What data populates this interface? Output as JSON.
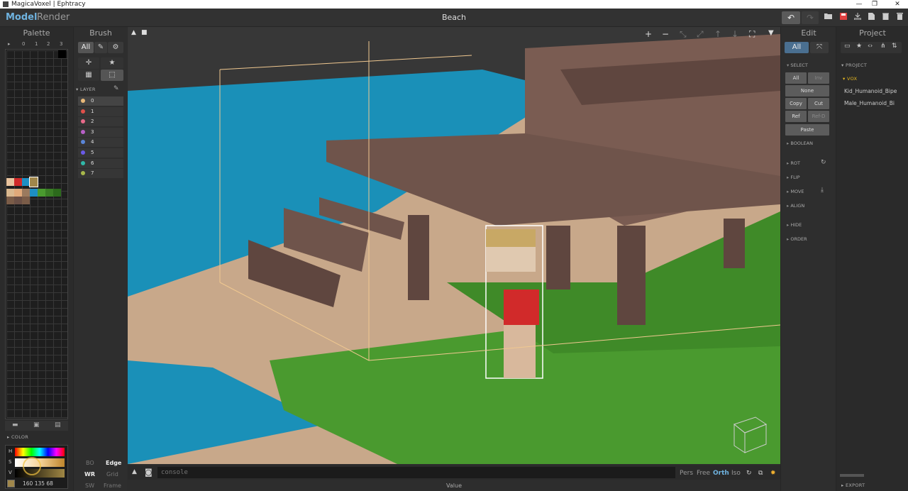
{
  "window": {
    "title": "MagicaVoxel | Ephtracy",
    "controls": [
      "—",
      "❐",
      "✕"
    ]
  },
  "menubar": {
    "tabs": [
      "Model",
      "Render"
    ],
    "scene_title": "Beach",
    "undo": "↶",
    "redo": "↷",
    "file_icons": [
      "open-folder-icon",
      "save-icon",
      "export-icon",
      "new-file-icon",
      "delete-icon"
    ]
  },
  "palette": {
    "title": "Palette",
    "header": [
      "▸",
      "0",
      "1",
      "2",
      "3"
    ],
    "swatch_colors": [
      "#e8c39e",
      "#d12a2a",
      "#1d8fc4",
      "#a0874b",
      "#d9b88f",
      "#9b7a5e",
      "#4a9a2f",
      "#3a7d25",
      "#2c6a1c",
      "#e0a97a",
      "#7a5c48",
      "#6b5046"
    ],
    "tools": [
      "open-icon",
      "save-icon",
      "file-icon"
    ],
    "color_label": "COLOR",
    "hsv_labels": [
      "H",
      "S",
      "V"
    ],
    "rgb": "160 135 68"
  },
  "brush": {
    "title": "Brush",
    "modes": [
      "All"
    ],
    "layer_label": "LAYER",
    "layers": [
      {
        "num": "0",
        "color": "#e8b878"
      },
      {
        "num": "1",
        "color": "#e0504a"
      },
      {
        "num": "2",
        "color": "#e86a8a"
      },
      {
        "num": "3",
        "color": "#b860c8"
      },
      {
        "num": "4",
        "color": "#5a86d8"
      },
      {
        "num": "5",
        "color": "#6a5ae8"
      },
      {
        "num": "6",
        "color": "#30b8a8"
      },
      {
        "num": "7",
        "color": "#a8b84a"
      }
    ],
    "bottom": [
      [
        "BO",
        "Edge"
      ],
      [
        "WR",
        "Grid"
      ],
      [
        "SW",
        "Frame"
      ]
    ]
  },
  "viewport": {
    "console_placeholder": "console",
    "camera_modes": [
      "Pers",
      "Free",
      "Orth",
      "Iso"
    ],
    "active_camera": "Orth",
    "toolbar": [
      "+",
      "−"
    ]
  },
  "status": {
    "value_label": "Value"
  },
  "edit": {
    "title": "Edit",
    "mode": "All",
    "select_label": "SELECT",
    "buttons": {
      "all": "All",
      "inv": "Inv",
      "none": "None",
      "copy": "Copy",
      "cut": "Cut",
      "ref": "Ref",
      "refd": "Ref-D",
      "paste": "Paste"
    },
    "sections": [
      "BOOLEAN",
      "ROT",
      "FLIP",
      "MOVE",
      "ALIGN",
      "HIDE",
      "ORDER"
    ]
  },
  "project": {
    "title": "Project",
    "section_label": "PROJECT",
    "folder": "VOX",
    "items": [
      "Kid_Humanoid_Bipe",
      "Male_Humanoid_Bi"
    ],
    "export_label": "EXPORT"
  }
}
